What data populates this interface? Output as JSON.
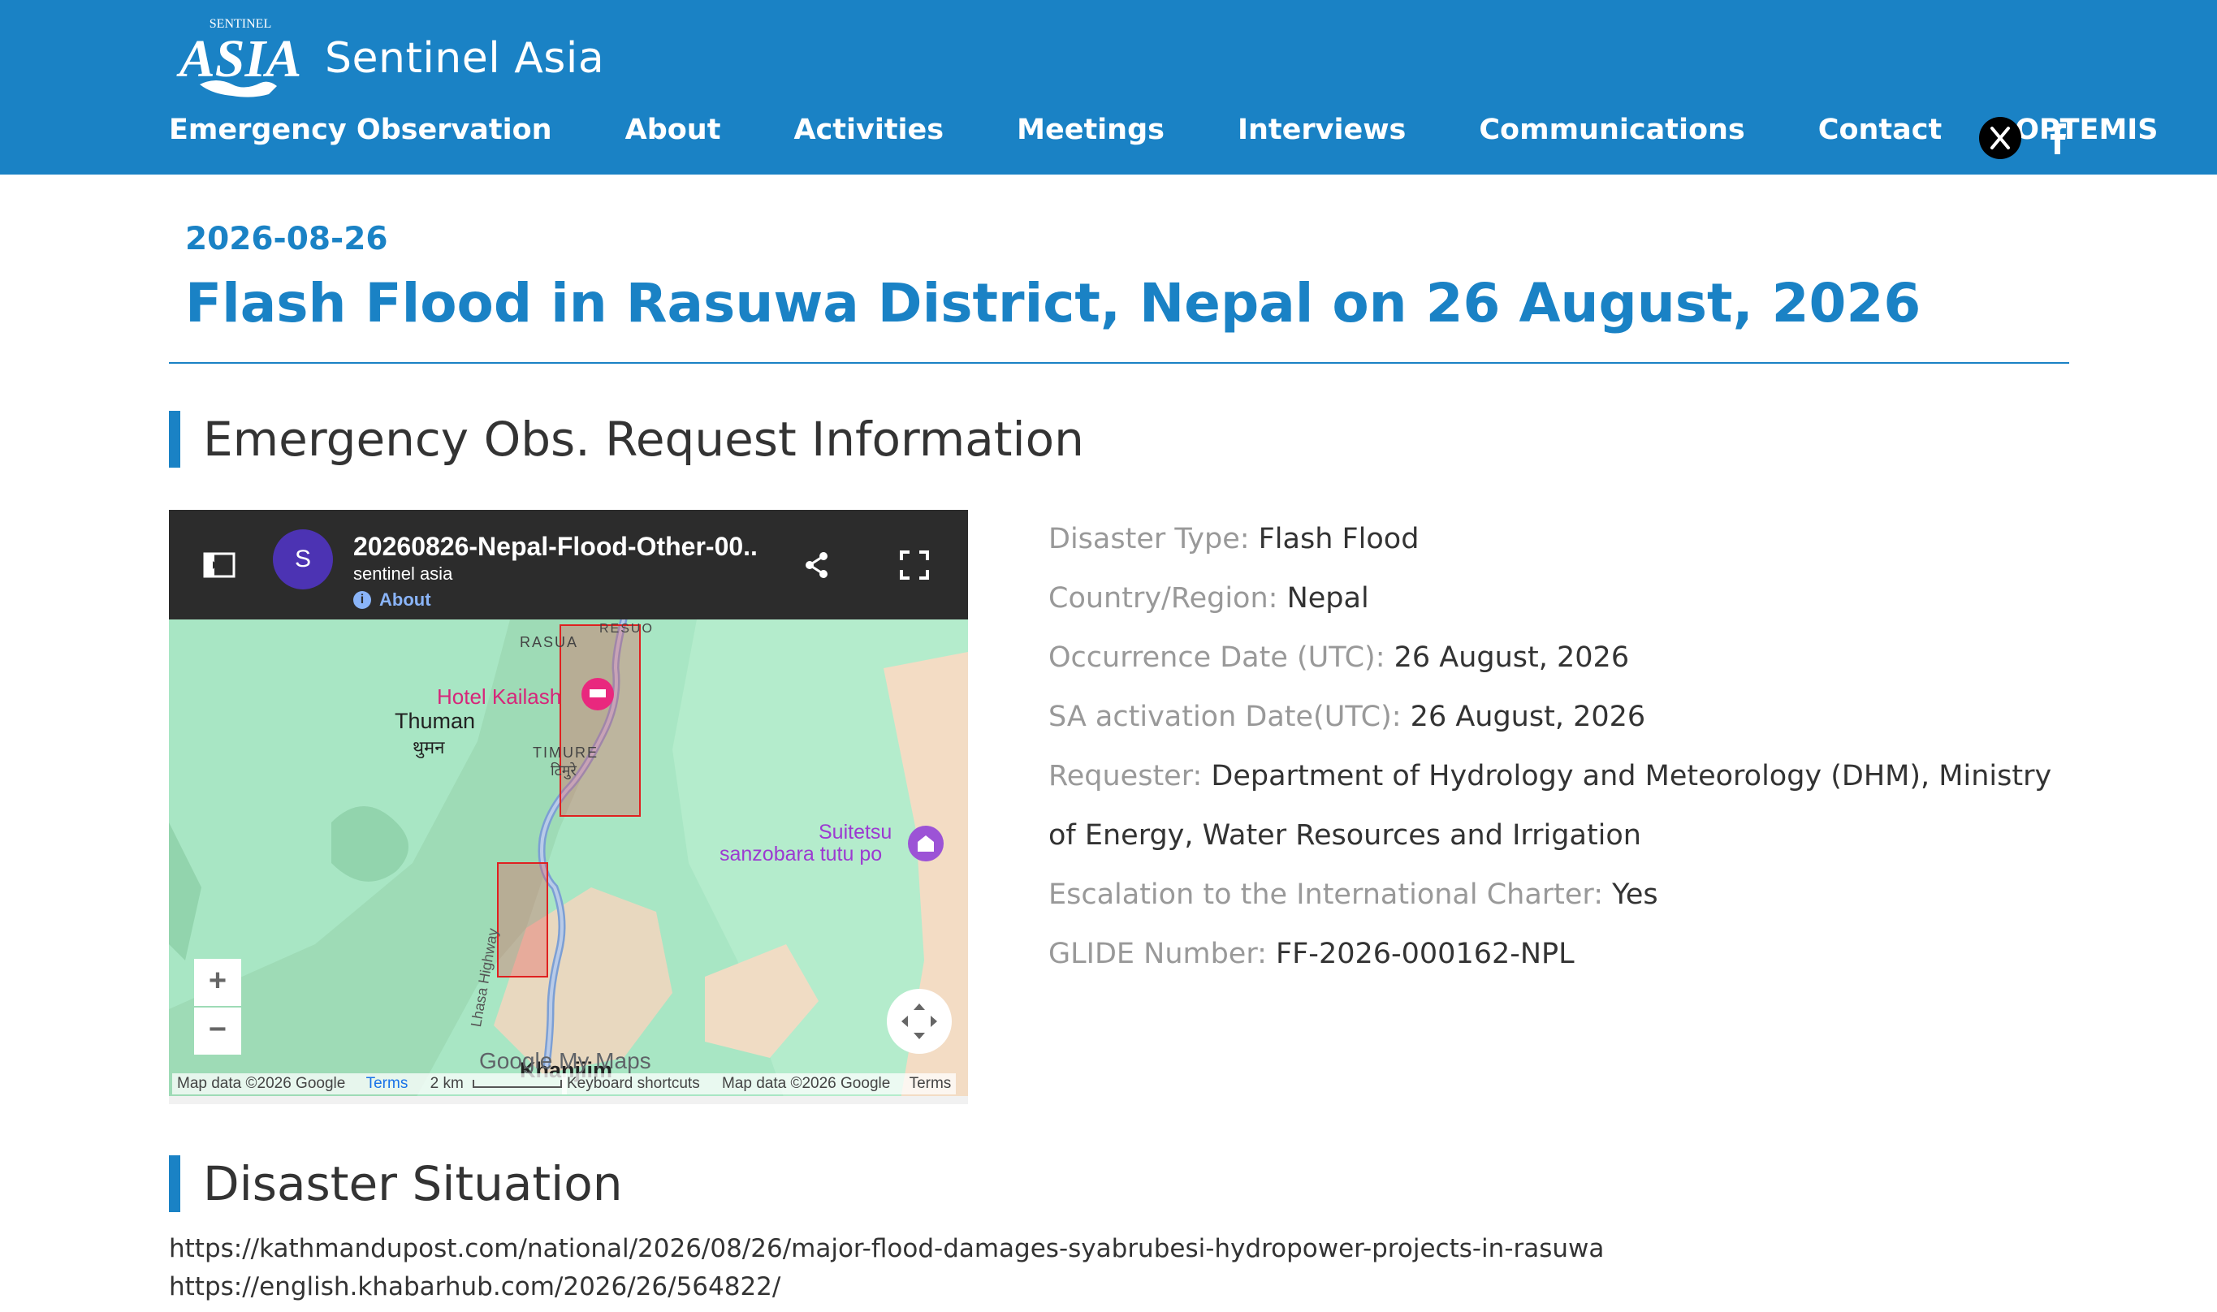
{
  "brand": {
    "logo_text": "Sentinel Asia"
  },
  "nav": {
    "items": [
      {
        "label": "Emergency Observation"
      },
      {
        "label": "About"
      },
      {
        "label": "Activities"
      },
      {
        "label": "Meetings"
      },
      {
        "label": "Interviews"
      },
      {
        "label": "Communications"
      },
      {
        "label": "Contact"
      },
      {
        "label": "OPTEMIS"
      }
    ],
    "social": [
      "x-icon",
      "facebook-icon"
    ]
  },
  "post": {
    "date": "2026-08-26",
    "title": "Flash Flood in Rasuwa District, Nepal on 26 August, 2026"
  },
  "sections": {
    "request": "Emergency Obs. Request Information",
    "situation": "Disaster Situation"
  },
  "map": {
    "avatar_letter": "S",
    "title": "20260826-Nepal-Flood-Other-00..",
    "subtitle": "sentinel asia",
    "about": "About",
    "places": {
      "rasua": "RASUA",
      "resuo": "RESUO",
      "hotel": "Hotel Kailash",
      "thuman": "Thuman",
      "thuman_np": "थुमन",
      "timure": "TIMURE",
      "timure_np": "टिमुरे",
      "suitetsu_1": "Suitetsu",
      "suitetsu_2": "sanzobara tutu po",
      "highway": "Lhasa Highway",
      "khanjim": "Khanjiim"
    },
    "zoom_in": "+",
    "zoom_out": "−",
    "brand": "Google My Maps",
    "attribution": {
      "left_data": "Map data ©2026 Google",
      "left_terms": "Terms",
      "scale": "2 km",
      "shortcuts": "Keyboard shortcuts",
      "right_data": "Map data ©2026 Google",
      "right_terms": "Terms"
    },
    "colors": {
      "flood_box": "#e02020",
      "river": "#7c9fd4",
      "terrain": "#a8e6c4"
    }
  },
  "info": [
    {
      "label": "Disaster Type: ",
      "value": "Flash Flood"
    },
    {
      "label": "Country/Region: ",
      "value": "Nepal"
    },
    {
      "label": "Occurrence Date (UTC): ",
      "value": "26 August, 2026"
    },
    {
      "label": "SA activation Date(UTC): ",
      "value": "26 August, 2026"
    },
    {
      "label": "Requester: ",
      "value": "Department of Hydrology and Meteorology (DHM), Ministry of Energy, Water Resources and Irrigation"
    },
    {
      "label": "Escalation to the International Charter: ",
      "value": "Yes"
    },
    {
      "label": "GLIDE Number: ",
      "value": "FF-2026-000162-NPL"
    }
  ],
  "links": [
    "https://kathmandupost.com/national/2026/08/26/major-flood-damages-syabrubesi-hydropower-projects-in-rasuwa",
    "https://english.khabarhub.com/2026/26/564822/"
  ],
  "colors": {
    "brand_blue": "#1a82c5",
    "label_gray": "#999999",
    "text": "#333333"
  }
}
